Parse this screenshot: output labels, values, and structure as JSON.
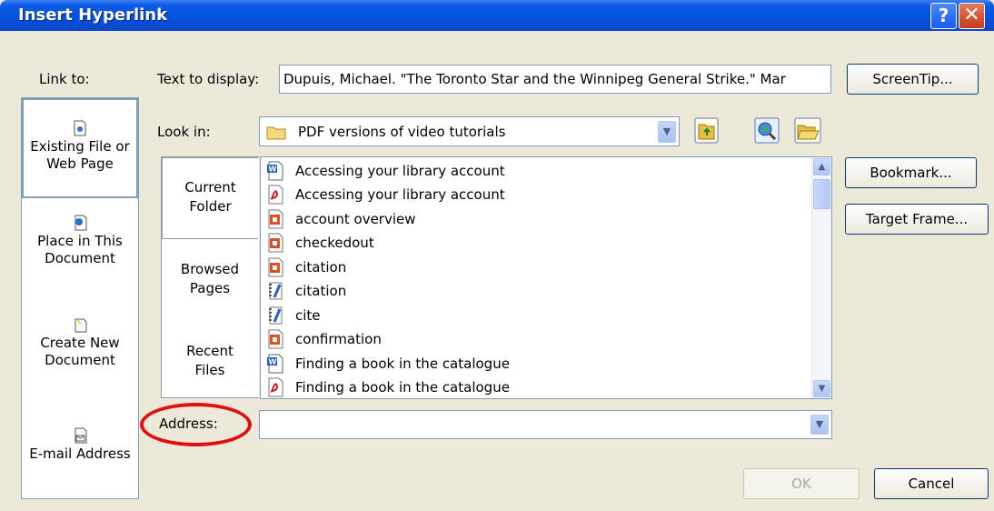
{
  "window": {
    "title": "Insert Hyperlink",
    "help_glyph": "?",
    "close_glyph": "✕"
  },
  "link_to": {
    "label": "Link to:",
    "items": [
      {
        "label_1": "Existing File or",
        "label_2": "Web Page",
        "icon": "existing-file-icon"
      },
      {
        "label_1": "Place in This",
        "label_2": "Document",
        "icon": "place-in-document-icon"
      },
      {
        "label_1": "Create New",
        "label_2": "Document",
        "icon": "create-new-document-icon"
      },
      {
        "label_1": "E-mail Address",
        "label_2": "",
        "icon": "email-address-icon"
      }
    ]
  },
  "text_to_display": {
    "label": "Text to display:",
    "value": "Dupuis, Michael. \"The Toronto Star and the Winnipeg General Strike.\" Mar"
  },
  "look_in": {
    "label": "Look in:",
    "value": "PDF versions of video tutorials"
  },
  "tabs": [
    {
      "label_1": "Current",
      "label_2": "Folder"
    },
    {
      "label_1": "Browsed",
      "label_2": "Pages"
    },
    {
      "label_1": "Recent",
      "label_2": "Files"
    }
  ],
  "files": [
    {
      "name": "Accessing your library account",
      "type": "word"
    },
    {
      "name": "Accessing your library account",
      "type": "pdf"
    },
    {
      "name": "account overview",
      "type": "ppt"
    },
    {
      "name": "checkedout",
      "type": "ppt"
    },
    {
      "name": "citation",
      "type": "ppt"
    },
    {
      "name": "citation",
      "type": "notebook"
    },
    {
      "name": "cite",
      "type": "notebook"
    },
    {
      "name": "confirmation",
      "type": "ppt"
    },
    {
      "name": "Finding a book in the catalogue",
      "type": "word"
    },
    {
      "name": "Finding a book in the catalogue",
      "type": "pdf"
    }
  ],
  "address": {
    "label": "Address:",
    "value": ""
  },
  "buttons": {
    "screentip": "ScreenTip...",
    "bookmark": "Bookmark...",
    "target_frame": "Target Frame...",
    "ok": "OK",
    "cancel": "Cancel"
  },
  "colors": {
    "title_bar": "#0550dc",
    "highlight_circle": "#e01010",
    "dialog_bg": "#ece9d8"
  }
}
